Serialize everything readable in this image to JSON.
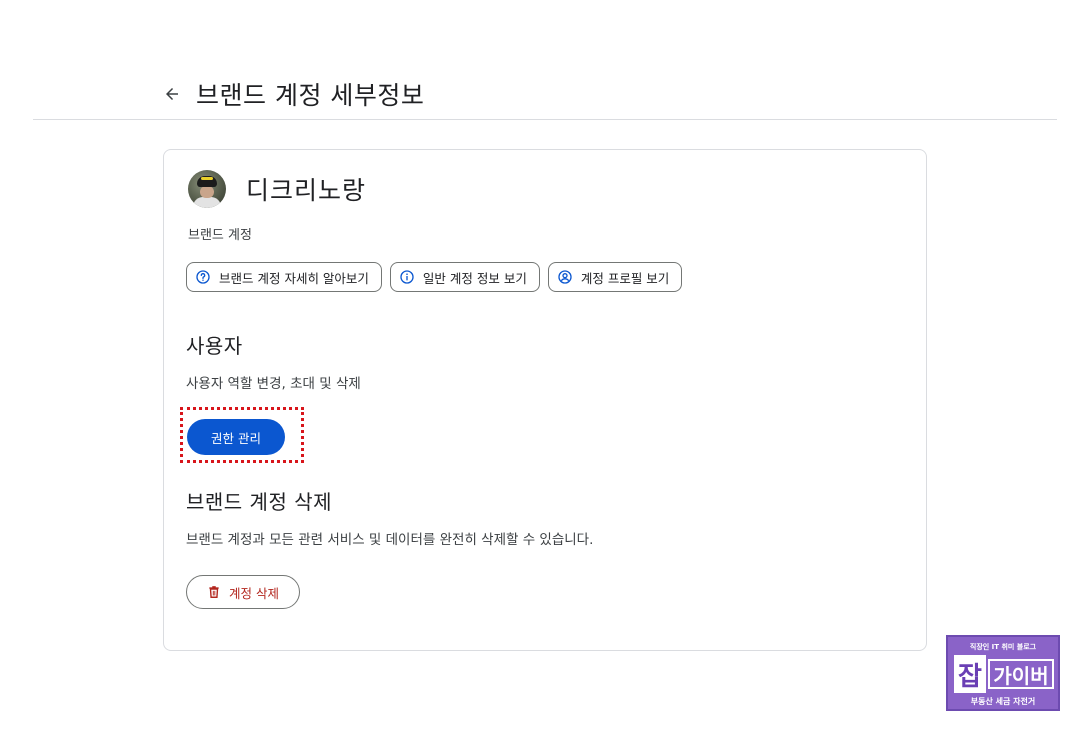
{
  "header": {
    "title": "브랜드 계정 세부정보",
    "back_icon": "arrow-back-icon"
  },
  "account": {
    "name": "디크리노랑",
    "type": "브랜드 계정"
  },
  "chips": [
    {
      "label": "브랜드 계정 자세히 알아보기",
      "icon": "help-circle-icon"
    },
    {
      "label": "일반 계정 정보 보기",
      "icon": "info-icon"
    },
    {
      "label": "계정 프로필 보기",
      "icon": "account-circle-icon"
    }
  ],
  "users_section": {
    "title": "사용자",
    "description": "사용자 역할 변경, 초대 및 삭제",
    "button_label": "권한 관리"
  },
  "delete_section": {
    "title": "브랜드 계정 삭제",
    "description": "브랜드 계정과 모든 관련 서비스 및 데이터를 완전히 삭제할 수 있습니다.",
    "button_label": "계정 삭제",
    "button_icon": "trash-icon"
  },
  "watermark": {
    "top": "직장인 IT 취미 블로그",
    "left": "잡",
    "right": "가이버",
    "bottom": "부동산 세금 자전거"
  },
  "colors": {
    "primary": "#0b57d0",
    "danger": "#b3261e",
    "highlight": "#d8151b",
    "border": "#dadce0"
  }
}
